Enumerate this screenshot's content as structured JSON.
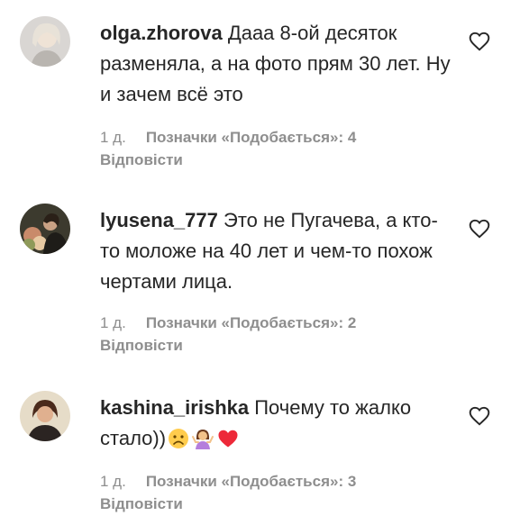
{
  "comments": [
    {
      "username": "olga.zhorova",
      "text": "Дааа 8-ой десяток разменяла, а на фото прям 30 лет. Ну и зачем всё это",
      "time": "1 д.",
      "likes_label": "Позначки «Подобається»: 4",
      "reply_label": "Відповісти",
      "avatar_icon": "profile-photo-avatar"
    },
    {
      "username": "lyusena_777",
      "text": "Это не Пугачева, а кто-то моложе на 40 лет и чем-то похож чертами лица.",
      "time": "1 д.",
      "likes_label": "Позначки «Подобається»: 2",
      "reply_label": "Відповісти",
      "avatar_icon": "profile-photo-avatar"
    },
    {
      "username": "kashina_irishka",
      "text": "Почему то жалко стало))",
      "emojis": [
        "sad-face-emoji",
        "shrugging-woman-emoji",
        "red-heart-emoji"
      ],
      "time": "1 д.",
      "likes_label": "Позначки «Подобається»: 3",
      "reply_label": "Відповісти",
      "avatar_icon": "profile-photo-avatar"
    }
  ],
  "colors": {
    "text": "#262626",
    "secondary": "#8e8e8e",
    "heart_outline": "#262626",
    "emoji_heart": "#ed2939",
    "emoji_face": "#ffcc4d"
  },
  "icons": {
    "like": "heart-outline-icon"
  }
}
